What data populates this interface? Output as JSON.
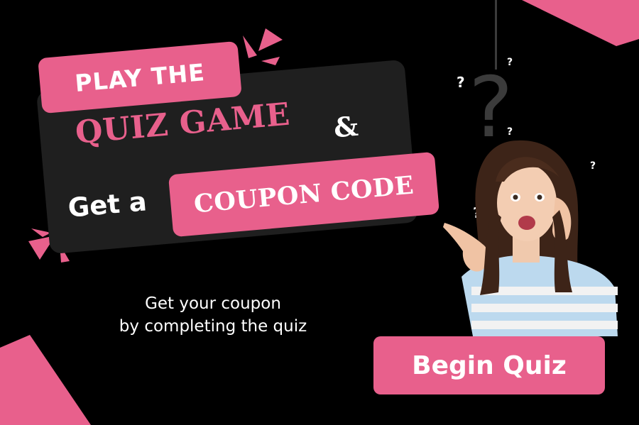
{
  "promo": {
    "headline_line1": "PLAY THE",
    "headline_line2": "QUIZ GAME",
    "ampersand": "&",
    "get_a": "Get a",
    "coupon_code": "COUPON CODE",
    "subtitle_line1": "Get your coupon",
    "subtitle_line2": "by completing the quiz",
    "cta_label": "Begin Quiz"
  },
  "decorations": {
    "question_marks": [
      "?",
      "?",
      "?",
      "?",
      "?",
      "?"
    ],
    "big_question_mark": "?"
  },
  "colors": {
    "background": "#000000",
    "accent_pink": "#e8608c",
    "panel_dark": "#1f1f1f",
    "text_white": "#ffffff"
  }
}
